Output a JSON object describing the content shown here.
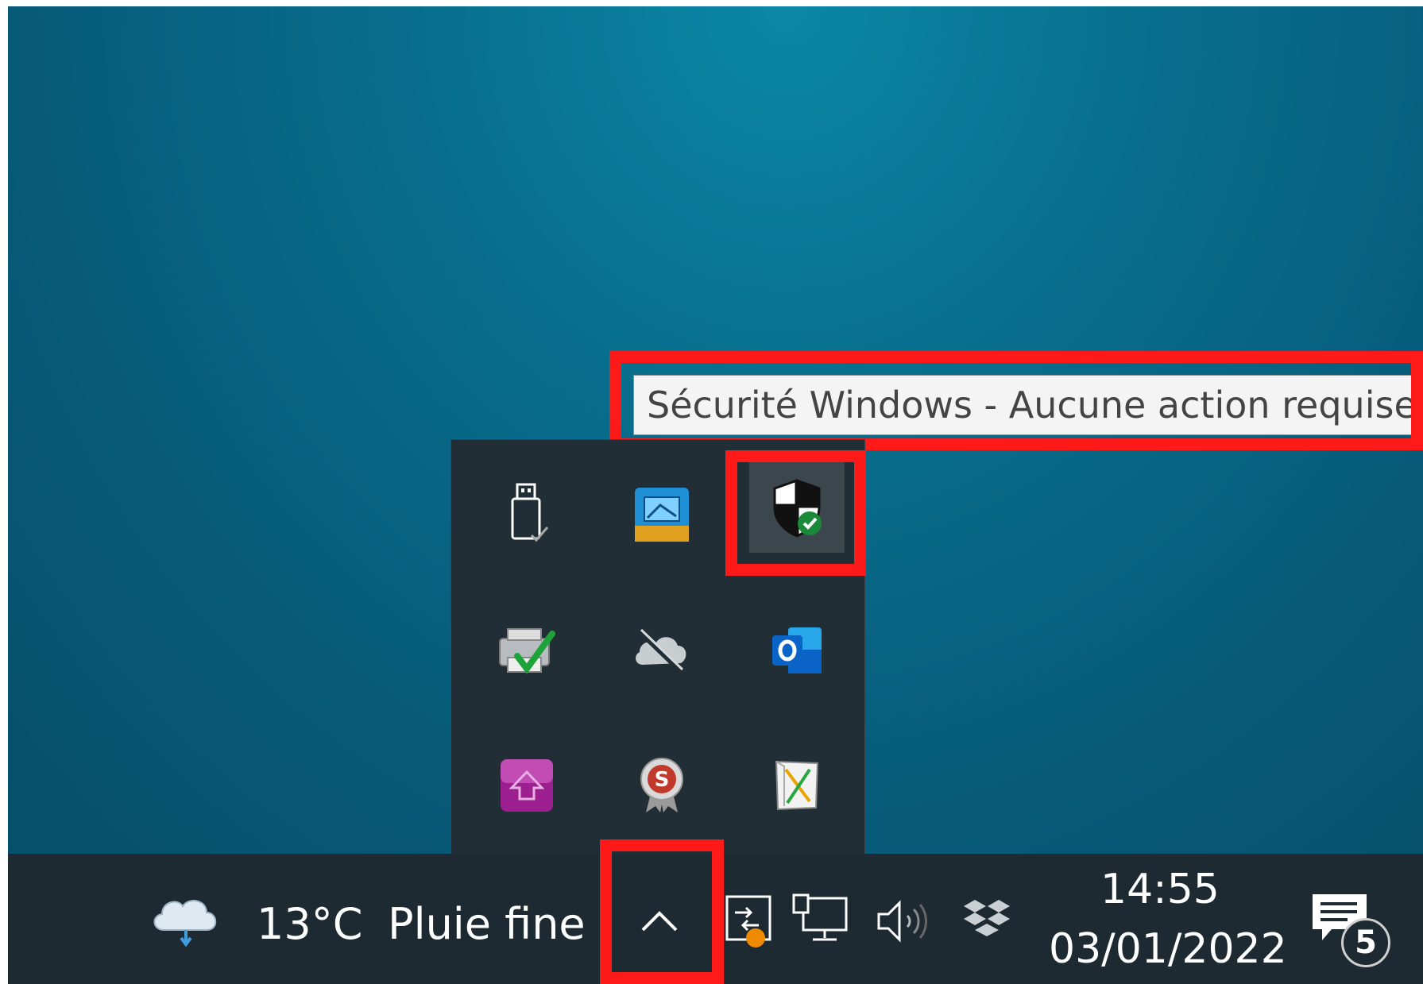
{
  "tooltip": {
    "text": "Sécurité Windows - Aucune action requise."
  },
  "tray_icons": [
    "usb-eject-icon",
    "intel-graphics-icon",
    "windows-security-icon",
    "printer-check-icon",
    "onedrive-offline-icon",
    "outlook-icon",
    "purple-upload-icon",
    "seal-s-icon",
    "notepad-x-icon"
  ],
  "taskbar": {
    "weather": {
      "temperature": "13°C",
      "condition": "Pluie fine"
    },
    "clock": {
      "time": "14:55",
      "date": "03/01/2022"
    },
    "notifications": {
      "count": "5"
    }
  },
  "colors": {
    "highlight": "#ff1a1a",
    "security_badge": "#1a8a3a",
    "outlook": "#0a64c8"
  }
}
